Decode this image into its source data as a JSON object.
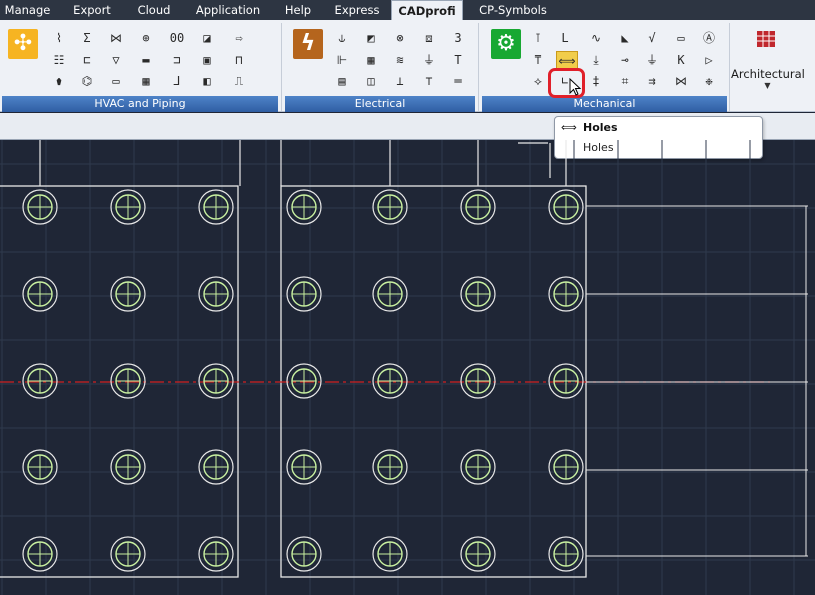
{
  "tabs": [
    {
      "label": "Manage",
      "active": false
    },
    {
      "label": "Export",
      "active": false
    },
    {
      "label": "Cloud",
      "active": false
    },
    {
      "label": "Application",
      "active": false
    },
    {
      "label": "Help",
      "active": false
    },
    {
      "label": "Express",
      "active": false
    },
    {
      "label": "CADprofi",
      "active": true
    },
    {
      "label": "CP-Symbols",
      "active": false
    }
  ],
  "panels": {
    "hvac": {
      "title": "HVAC and Piping",
      "big_icon": "fan-icon",
      "big_color": "#f6b422"
    },
    "electrical": {
      "title": "Electrical",
      "big_icon": "lightning-icon",
      "big_color": "#b5651d"
    },
    "mechanical": {
      "title": "Mechanical",
      "big_icon": "gears-icon",
      "big_color": "#18a832"
    },
    "architectural": {
      "title": "Architectural",
      "icon": "grid-brick-icon",
      "icon_color": "#c0272d"
    }
  },
  "tooltip": {
    "title": "Holes",
    "description": "Holes",
    "icon": "holes-icon"
  },
  "colors": {
    "accent": "#2f5ea3",
    "canvas": "#1f2636",
    "highlight": "#e0202a",
    "centerline": "#d02020",
    "hole": "#c8f0a0"
  }
}
